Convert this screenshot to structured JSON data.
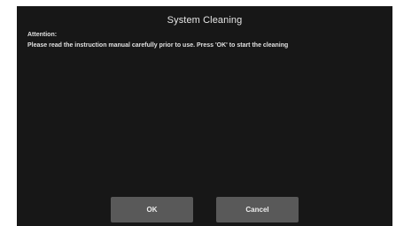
{
  "dialog": {
    "title": "System Cleaning",
    "attention_label": "Attention:",
    "message": "Please read the instruction manual carefully  prior to use. Press 'OK' to start the cleaning"
  },
  "buttons": {
    "ok_label": "OK",
    "cancel_label": "Cancel"
  },
  "colors": {
    "background": "#171717",
    "button": "#595959",
    "text": "#e6e6e6"
  }
}
